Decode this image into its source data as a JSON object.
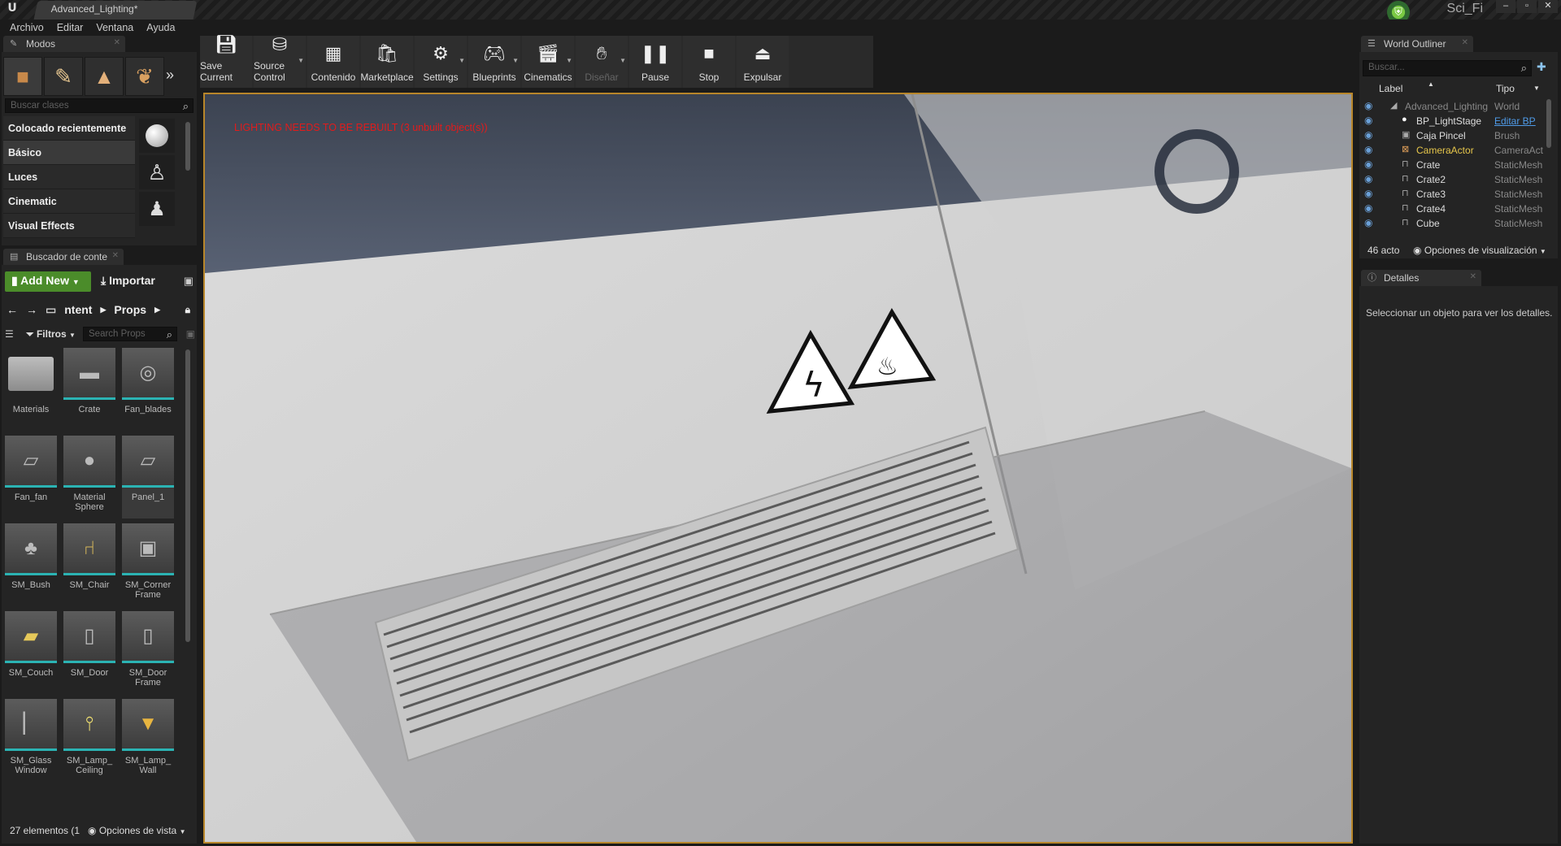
{
  "window": {
    "doc_tab": "Advanced_Lighting*",
    "project": "Sci_Fi",
    "buttons": [
      "–",
      "▫",
      "✕"
    ]
  },
  "menu": [
    "Archivo",
    "Editar",
    "Ventana",
    "Ayuda"
  ],
  "modes": {
    "tab": "Modos",
    "search_placeholder": "Buscar clases",
    "categories": [
      "Colocado recientemente",
      "Básico",
      "Luces",
      "Cinematic",
      "Visual Effects"
    ]
  },
  "toolbar": [
    {
      "label": "Save Current",
      "icon": "save-icon"
    },
    {
      "label": "Source Control",
      "icon": "source-control-icon",
      "dropdown": true
    },
    {
      "label": "Contenido",
      "icon": "content-icon"
    },
    {
      "label": "Marketplace",
      "icon": "marketplace-icon"
    },
    {
      "label": "Settings",
      "icon": "settings-icon",
      "dropdown": true
    },
    {
      "label": "Blueprints",
      "icon": "blueprints-icon",
      "dropdown": true
    },
    {
      "label": "Cinematics",
      "icon": "cinematics-icon",
      "dropdown": true
    },
    {
      "label": "Diseñar",
      "icon": "build-icon",
      "dropdown": true,
      "disabled": true
    },
    {
      "label": "Pause",
      "icon": "pause-icon"
    },
    {
      "label": "Stop",
      "icon": "stop-icon"
    },
    {
      "label": "Expulsar",
      "icon": "eject-icon"
    }
  ],
  "viewport": {
    "warning": "LIGHTING NEEDS TO BE REBUILT (3 unbuilt object(s))"
  },
  "content_browser": {
    "tab": "Buscador de conte",
    "add_new": "Add New",
    "import": "Importar",
    "path": [
      "ntent",
      "Props"
    ],
    "filters": "Filtros",
    "search_placeholder": "Search Props",
    "assets": [
      "Materials",
      "Crate",
      "Fan_blades",
      "Fan_fan",
      "Material Sphere",
      "Panel_1",
      "SM_Bush",
      "SM_Chair",
      "SM_Corner Frame",
      "SM_Couch",
      "SM_Door",
      "SM_Door Frame",
      "SM_Glass Window",
      "SM_Lamp_ Ceiling",
      "SM_Lamp_ Wall"
    ],
    "status": "27 elementos (1",
    "view_options": "Opciones de vista"
  },
  "outliner": {
    "tab": "World Outliner",
    "search_placeholder": "Buscar...",
    "col_label": "Label",
    "col_type": "Tipo",
    "rows": [
      {
        "label": "Advanced_Lighting",
        "type": "World"
      },
      {
        "label": "BP_LightStage",
        "type": "Editar BP"
      },
      {
        "label": "Caja Pincel",
        "type": "Brush"
      },
      {
        "label": "CameraActor",
        "type": "CameraAct"
      },
      {
        "label": "Crate",
        "type": "StaticMesh"
      },
      {
        "label": "Crate2",
        "type": "StaticMesh"
      },
      {
        "label": "Crate3",
        "type": "StaticMesh"
      },
      {
        "label": "Crate4",
        "type": "StaticMesh"
      },
      {
        "label": "Cube",
        "type": "StaticMesh"
      }
    ],
    "status": "46 acto",
    "view_options": "Opciones de visualización"
  },
  "details": {
    "tab": "Detalles",
    "message": "Seleccionar un objeto para ver los detalles."
  },
  "colors": {
    "accent_green": "#4b8c2a",
    "viewport_border": "#b8862a",
    "warning": "#e21b1b",
    "link": "#4f9be8"
  }
}
